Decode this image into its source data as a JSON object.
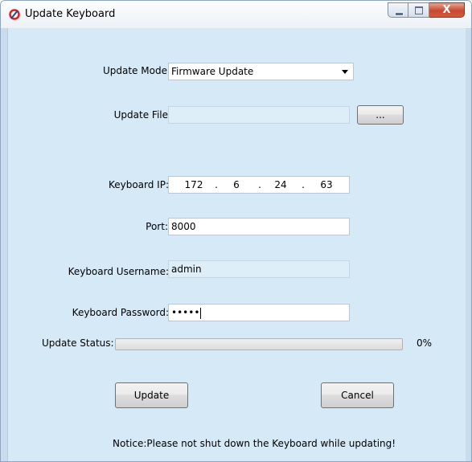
{
  "window": {
    "title": "Update Keyboard",
    "close_glyph": "X"
  },
  "form": {
    "update_mode": {
      "label": "Update Mode:",
      "value": "Firmware Update"
    },
    "update_file": {
      "label": "Update File",
      "value": "",
      "browse_label": "..."
    },
    "keyboard_ip": {
      "label": "Keyboard IP:",
      "octets": [
        "172",
        "6",
        "24",
        "63"
      ],
      "separator": "."
    },
    "port": {
      "label": "Port:",
      "value": "8000"
    },
    "username": {
      "label": "Keyboard Username:",
      "value": "admin"
    },
    "password": {
      "label": "Keyboard Password:",
      "masked_value": "•••••"
    },
    "status": {
      "label": "Update Status:",
      "percent_text": "0%",
      "progress": 0
    }
  },
  "buttons": {
    "update": "Update",
    "cancel": "Cancel"
  },
  "notice": "Notice:Please not shut down the Keyboard while updating!",
  "colors": {
    "client_bg": "#d6e9f6",
    "close_button": "#c9482f",
    "progress_fill": "#2ebd2e"
  }
}
